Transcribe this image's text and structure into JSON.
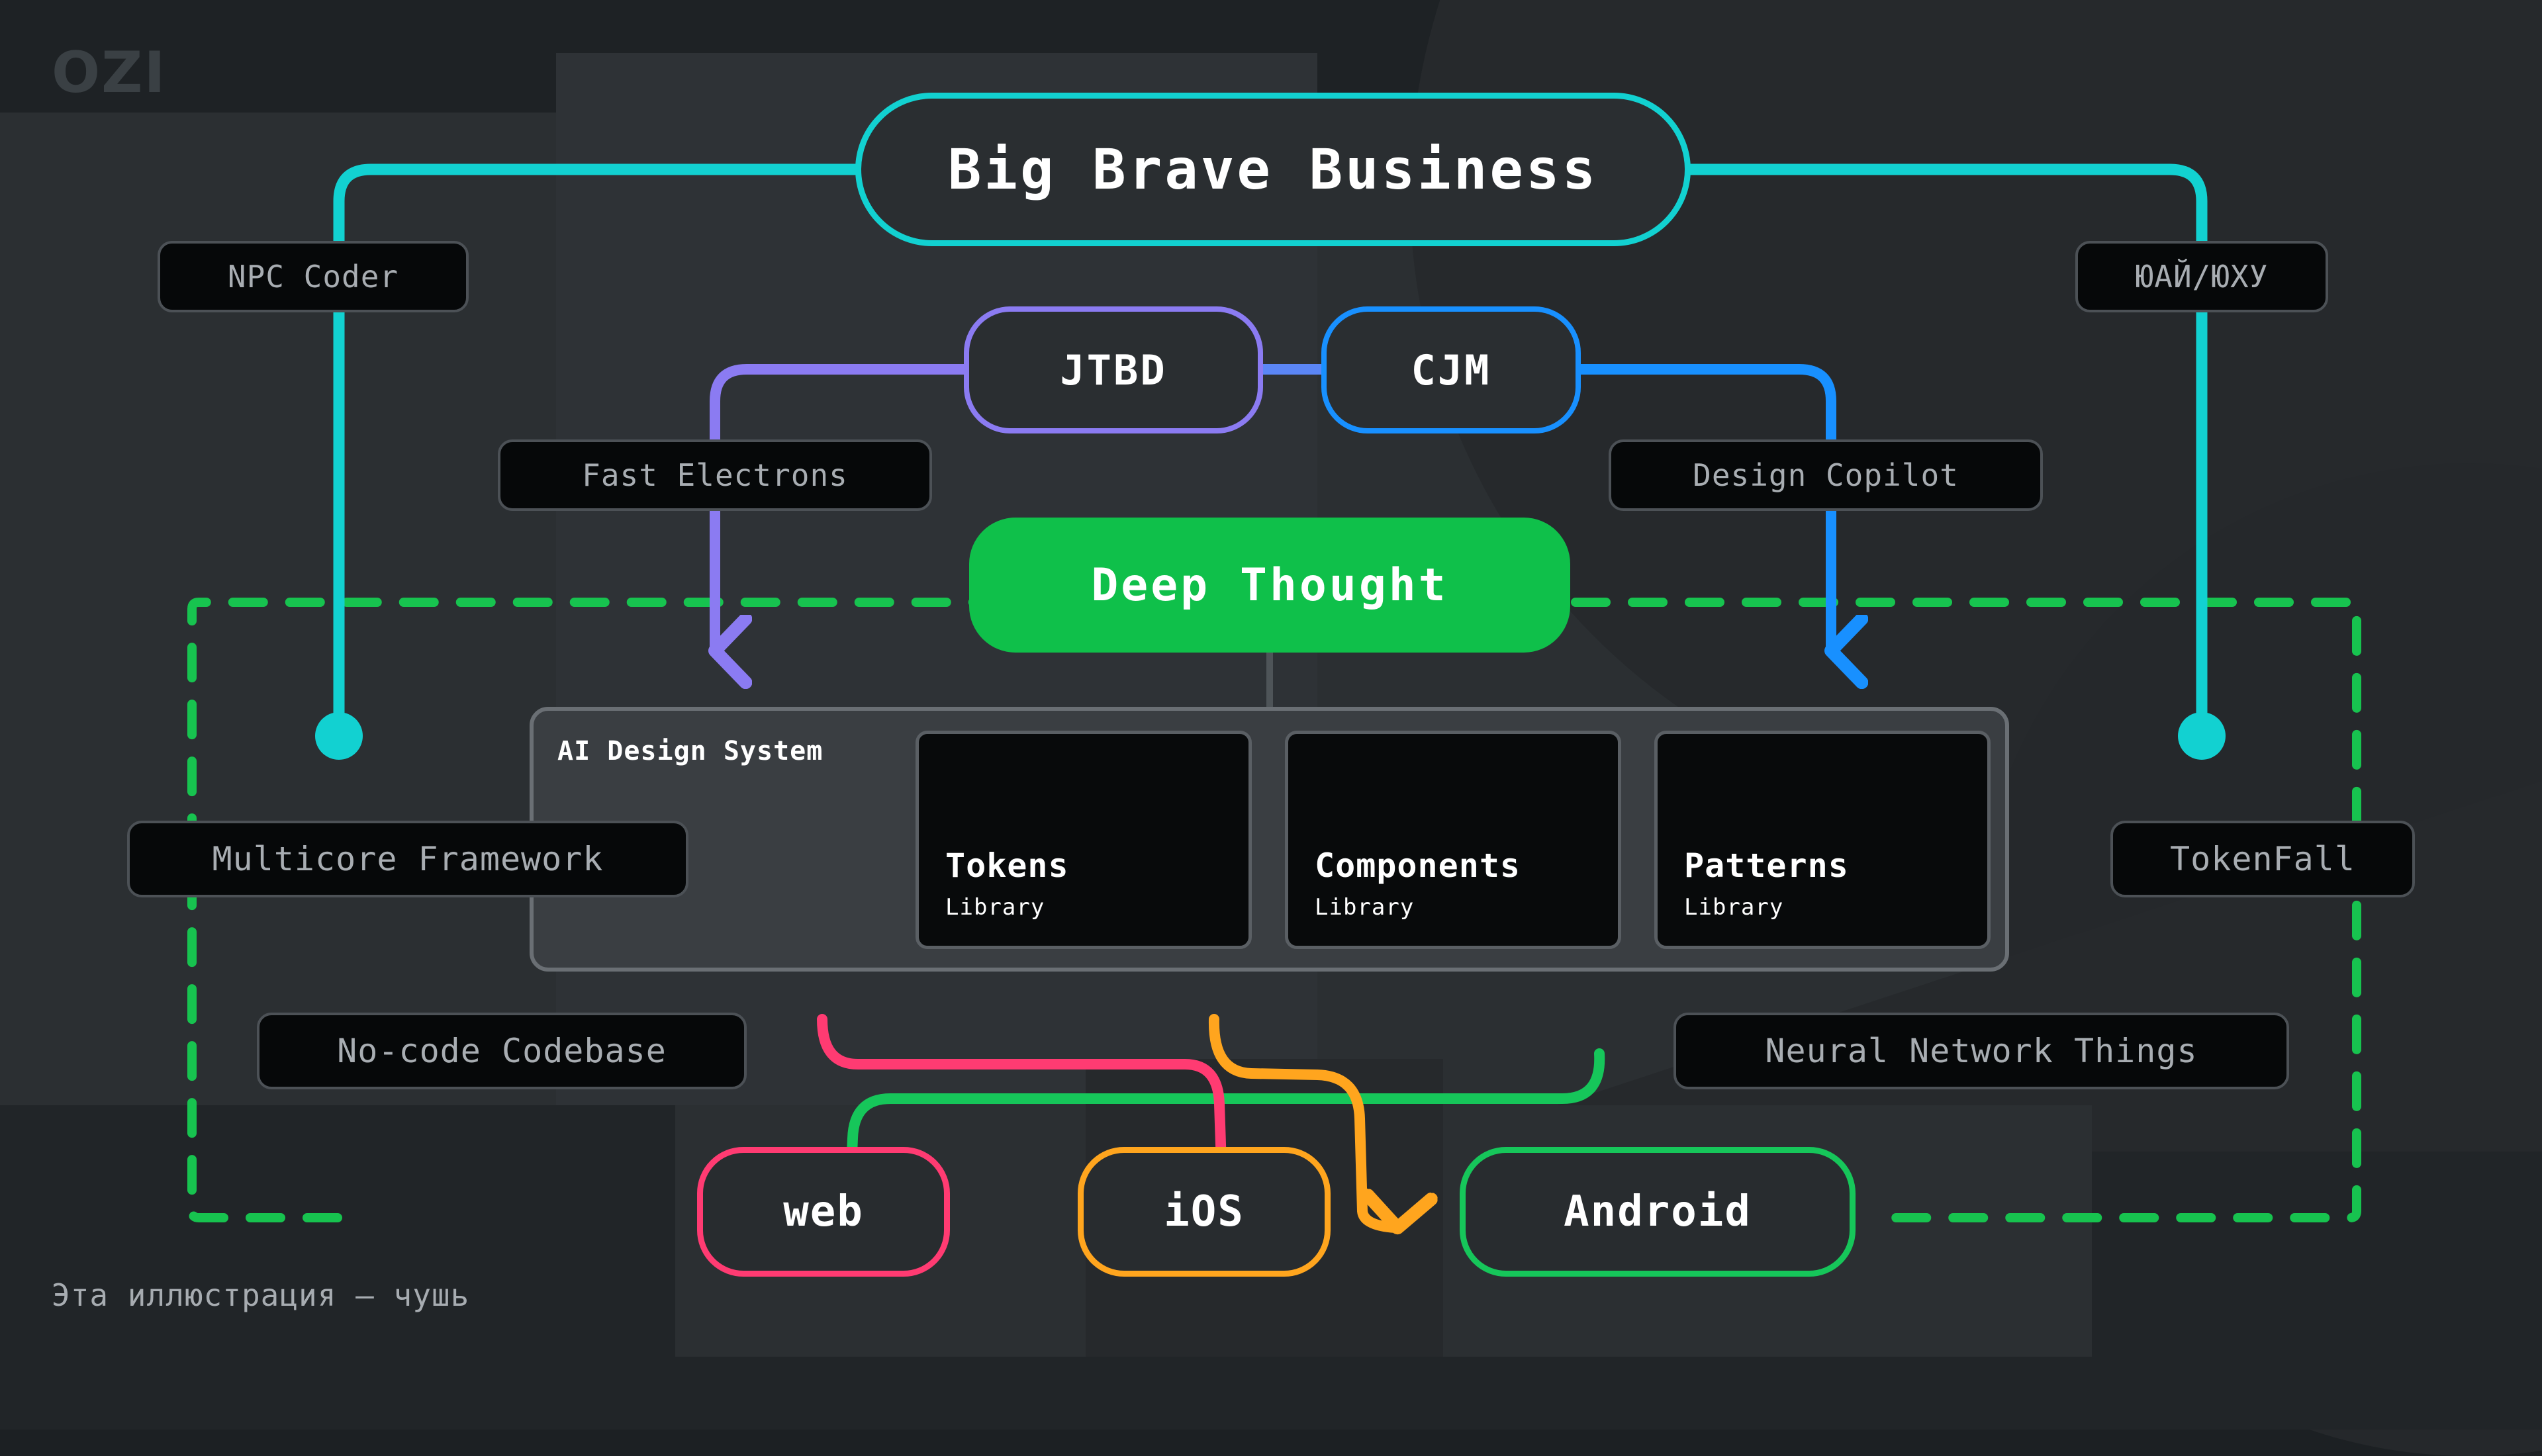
{
  "logo": {
    "text": "OZI"
  },
  "caption": {
    "text": "Эта иллюстрация — чушь"
  },
  "colors": {
    "cyan": "#12D1D1",
    "purple": "#8B7BF2",
    "blue": "#1890FF",
    "green": "#0FC04A",
    "green_bright": "#16C65A",
    "pink": "#FF3B72",
    "orange": "#FFA51E",
    "chip_text": "#a8adb2",
    "background": "#1e2225"
  },
  "nodes": {
    "root": {
      "label": "Big Brave Business"
    },
    "jtbd": {
      "label": "JTBD"
    },
    "cjm": {
      "label": "CJM"
    },
    "deep_thought": {
      "label": "Deep Thought"
    }
  },
  "design_system": {
    "title": "AI Design System",
    "cards": [
      {
        "name": "Tokens",
        "sub": "Library"
      },
      {
        "name": "Components",
        "sub": "Library"
      },
      {
        "name": "Patterns",
        "sub": "Library"
      }
    ]
  },
  "platforms": [
    {
      "label": "web"
    },
    {
      "label": "iOS"
    },
    {
      "label": "Android"
    }
  ],
  "chips": [
    {
      "id": "npc-coder",
      "label": "NPC Coder"
    },
    {
      "id": "yuay-yuhu",
      "label": "ЮАЙ/ЮХУ"
    },
    {
      "id": "fast-electrons",
      "label": "Fast Electrons"
    },
    {
      "id": "design-copilot",
      "label": "Design Copilot"
    },
    {
      "id": "multicore-framework",
      "label": "Multicore Framework"
    },
    {
      "id": "tokenfall",
      "label": "TokenFall"
    },
    {
      "id": "no-code-codebase",
      "label": "No-code Codebase"
    },
    {
      "id": "neural-network-things",
      "label": "Neural Network Things"
    }
  ]
}
